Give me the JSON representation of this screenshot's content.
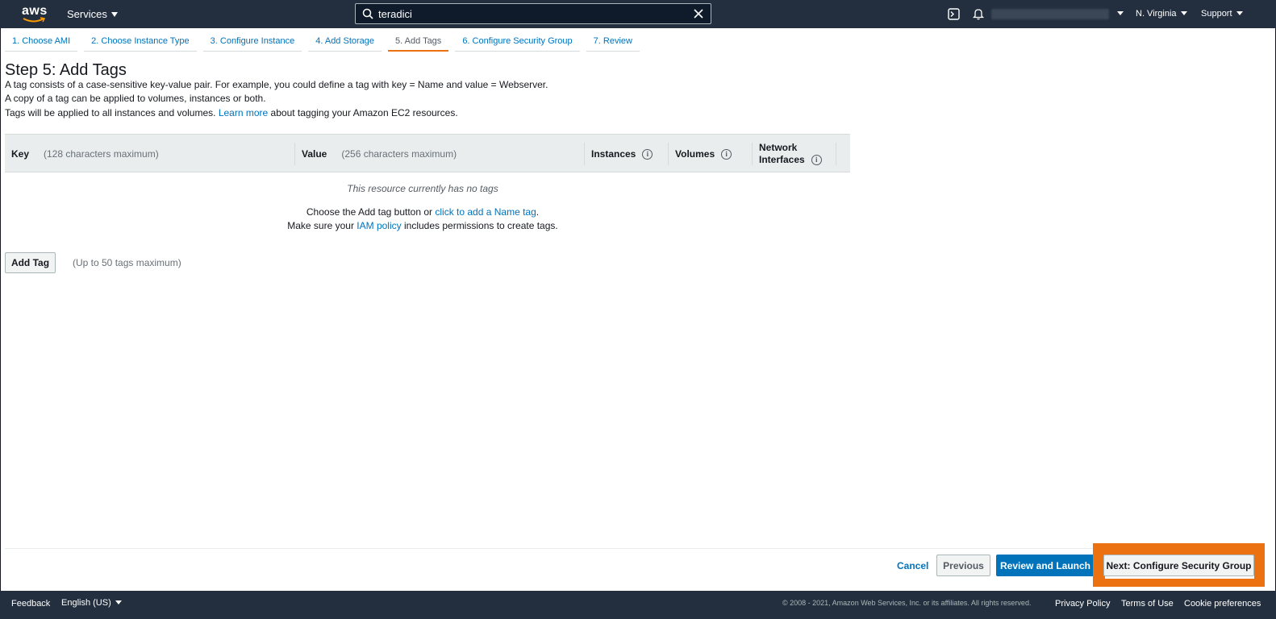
{
  "topnav": {
    "logo_text": "aws",
    "services_label": "Services",
    "search_value": "teradici",
    "region_label": "N. Virginia",
    "support_label": "Support"
  },
  "tabs": [
    {
      "label": "1. Choose AMI",
      "active": false
    },
    {
      "label": "2. Choose Instance Type",
      "active": false
    },
    {
      "label": "3. Configure Instance",
      "active": false
    },
    {
      "label": "4. Add Storage",
      "active": false
    },
    {
      "label": "5. Add Tags",
      "active": true
    },
    {
      "label": "6. Configure Security Group",
      "active": false
    },
    {
      "label": "7. Review",
      "active": false
    }
  ],
  "content": {
    "title": "Step 5: Add Tags",
    "desc1": "A tag consists of a case-sensitive key-value pair. For example, you could define a tag with key = Name and value = Webserver.",
    "desc2": "A copy of a tag can be applied to volumes, instances or both.",
    "desc3_prefix": "Tags will be applied to all instances and volumes.",
    "desc3_link": "Learn more",
    "desc3_suffix": "about tagging your Amazon EC2 resources."
  },
  "table": {
    "key_header": "Key",
    "key_hint": "(128 characters maximum)",
    "value_header": "Value",
    "value_hint": "(256 characters maximum)",
    "instances_header": "Instances",
    "volumes_header": "Volumes",
    "network_header_line1": "Network",
    "network_header_line2": "Interfaces",
    "info_glyph": "i",
    "empty_message": "This resource currently has no tags",
    "choose_prefix": "Choose the Add tag button or",
    "choose_link": "click to add a Name tag",
    "choose_suffix": ".",
    "ensure_prefix": "Make sure your",
    "ensure_link": "IAM policy",
    "ensure_suffix": "includes permissions to create tags."
  },
  "add_tag": {
    "button_label": "Add Tag",
    "hint": "(Up to 50 tags maximum)"
  },
  "actions": {
    "cancel": "Cancel",
    "previous": "Previous",
    "review": "Review and Launch",
    "next": "Next: Configure Security Group",
    "highlight_color": "#ec7211"
  },
  "footer": {
    "feedback": "Feedback",
    "language": "English (US)",
    "copyright": "© 2008 - 2021, Amazon Web Services, Inc. or its affiliates. All rights reserved.",
    "privacy": "Privacy Policy",
    "terms": "Terms of Use",
    "cookies": "Cookie preferences"
  },
  "colors": {
    "nav_bg": "#232f3e",
    "link": "#0073bb",
    "primary": "#0073bb",
    "accent": "#ec7211"
  }
}
